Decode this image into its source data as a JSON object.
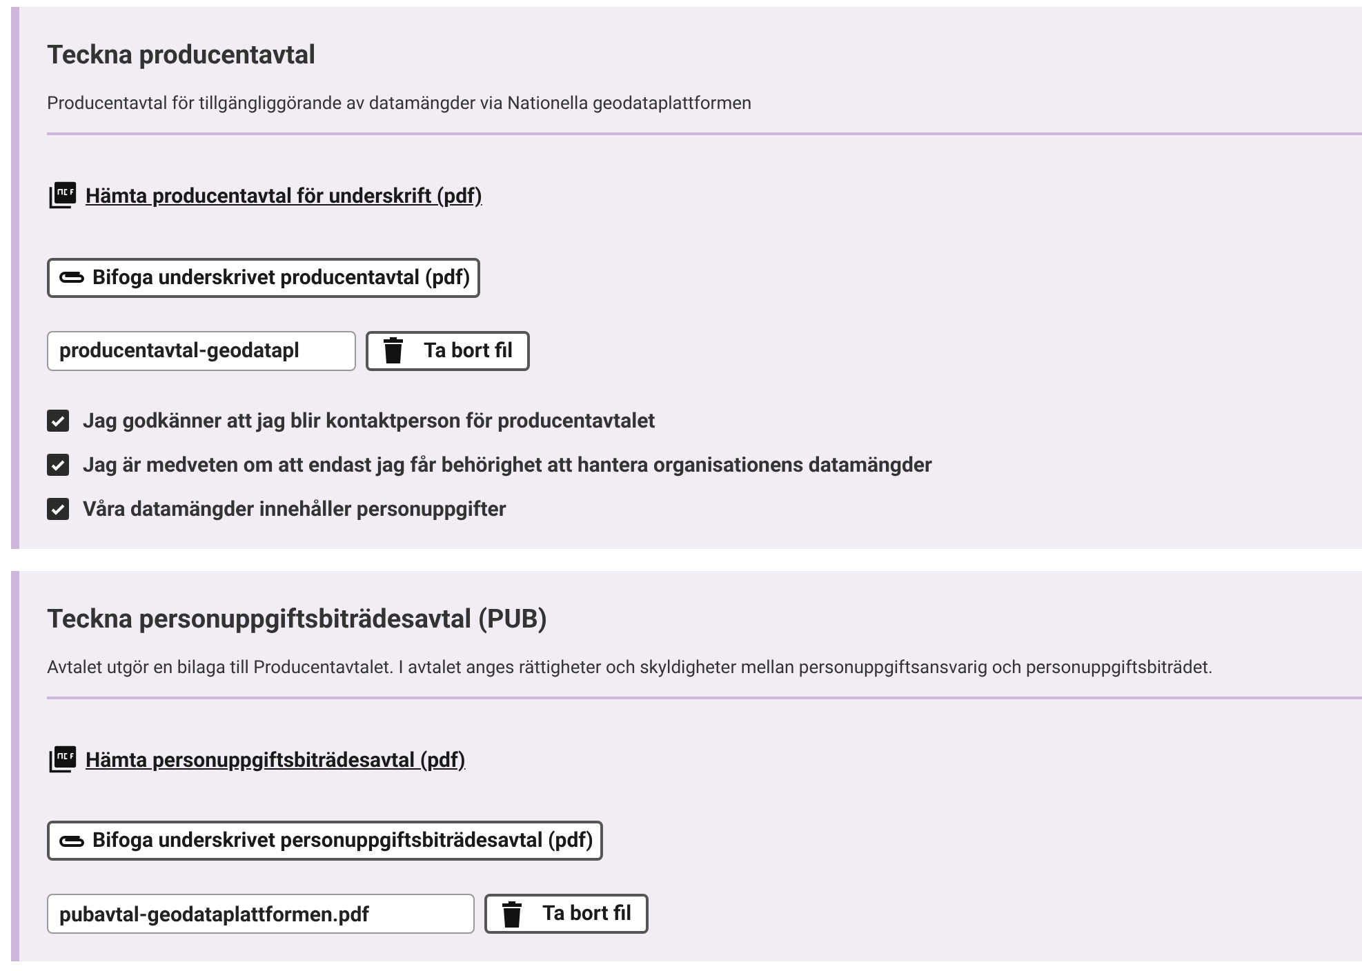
{
  "sections": [
    {
      "title": "Teckna producentavtal",
      "description": "Producentavtal för tillgängliggörande av datamängder via Nationella geodataplattformen",
      "download_link": "Hämta producentavtal för underskrift (pdf)",
      "attach_button": "Bifoga underskrivet producentavtal (pdf)",
      "file_field": {
        "value": "producentavtal-geodatapl"
      },
      "remove_button": "Ta bort fil",
      "checkboxes": [
        {
          "label": "Jag godkänner att jag blir kontaktperson för producentavtalet",
          "checked": true
        },
        {
          "label": "Jag är medveten om att endast jag får behörighet att hantera organisationens datamängder",
          "checked": true
        },
        {
          "label": "Våra datamängder innehåller personuppgifter",
          "checked": true
        }
      ]
    },
    {
      "title": "Teckna personuppgiftsbiträdesavtal (PUB)",
      "description": "Avtalet utgör en bilaga till Producentavtalet. I avtalet anges rättigheter och skyldigheter mellan personuppgiftsansvarig och personuppgiftsbiträdet.",
      "download_link": "Hämta personuppgiftsbiträdesavtal (pdf)",
      "attach_button": "Bifoga underskrivet personuppgiftsbiträdesavtal (pdf)",
      "file_field": {
        "value": "pubavtal-geodataplattformen.pdf"
      },
      "remove_button": "Ta bort fil"
    }
  ]
}
